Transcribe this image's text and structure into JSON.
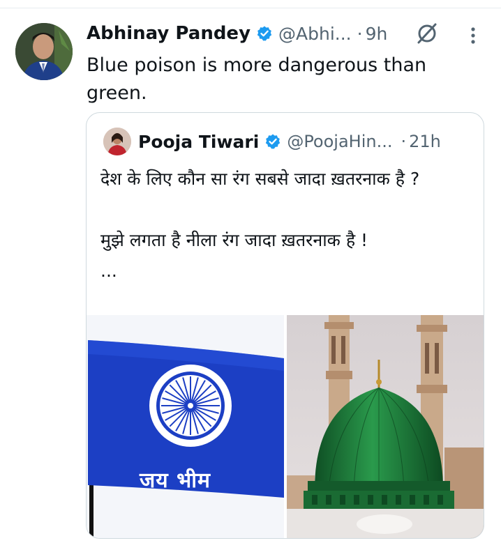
{
  "tweet": {
    "author_name": "Abhinay Pandey",
    "author_handle": "@Abhi...",
    "separator": "·",
    "time": "9h",
    "text": "Blue poison is more dangerous than green.",
    "icons": [
      "verified-badge-icon",
      "grok-icon",
      "more-options-icon"
    ]
  },
  "quoted_tweet": {
    "author_name": "Pooja Tiwari",
    "author_handle": "@PoojaHin...",
    "separator": "·",
    "time": "21h",
    "text": "देश के लिए कौन सा रंग सबसे जादा ख़तरनाक है ?\n\nमुझे लगता है नीला रंग जादा ख़तरनाक है !\n...",
    "media": {
      "left_image_caption": "जय भीम",
      "right_image": "green-dome-mosque"
    }
  },
  "colors": {
    "text_primary": "#0f1419",
    "text_secondary": "#536471",
    "verified_blue": "#1d9bf0",
    "border": "#cfd9de",
    "flag_blue": "#1c3fc4",
    "dome_green": "#1e7a3a"
  }
}
